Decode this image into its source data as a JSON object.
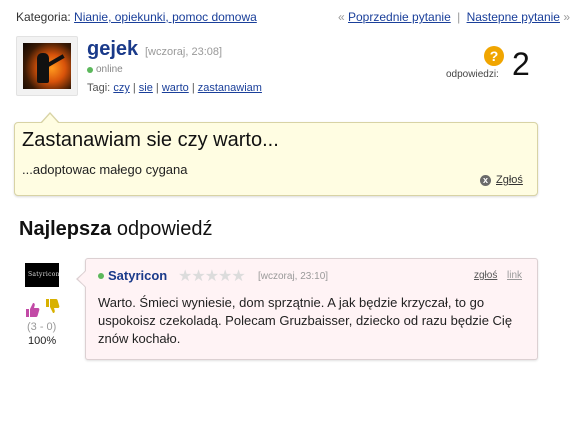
{
  "topbar": {
    "category_label": "Kategoria:",
    "category_link": "Nianie, opiekunki, pomoc domowa",
    "prev_arrow": "«",
    "prev_label": "Poprzednie pytanie",
    "divider": "|",
    "next_label": "Nastepne pytanie",
    "next_arrow": "»"
  },
  "question": {
    "username": "gejek",
    "time": "[wczoraj, 23:08]",
    "status": "online",
    "tags_label": "Tagi:",
    "tags": [
      "czy",
      "sie",
      "warto",
      "zastanawiam"
    ],
    "answers_icon": "?",
    "answers_label": "odpowiedzi:",
    "answers_count": "2",
    "title": "Zastanawiam sie czy warto...",
    "body": "...adoptowac małego cygana",
    "report_icon": "x",
    "report_label": "Zgłoś"
  },
  "best": {
    "heading_bold": "Najlepsza",
    "heading_rest": " odpowiedź"
  },
  "answer": {
    "avatar_text": "Satyricon",
    "username": "Satyricon",
    "stars": "★★★★★",
    "rating": 0,
    "time": "[wczoraj, 23:10]",
    "report_label": "zgłoś",
    "link_label": "link",
    "body": "Warto. Śmieci wyniesie, dom sprzątnie. A jak będzie krzyczał, to go uspokoisz czekoladą. Polecam Gruzbaisser, dziecko od razu będzie Cię znów kochało.",
    "votes": "(3 - 0)",
    "percent": "100%",
    "thumb_up_icon": "thumb-up-icon",
    "thumb_down_icon": "thumb-down-icon"
  },
  "colors": {
    "link": "#1a3f9a",
    "username": "#1a3a8a",
    "online": "#5cb85c",
    "question_bg": "#fffde2",
    "answer_bg": "#fff3f5",
    "answers_badge": "#f0a500"
  }
}
